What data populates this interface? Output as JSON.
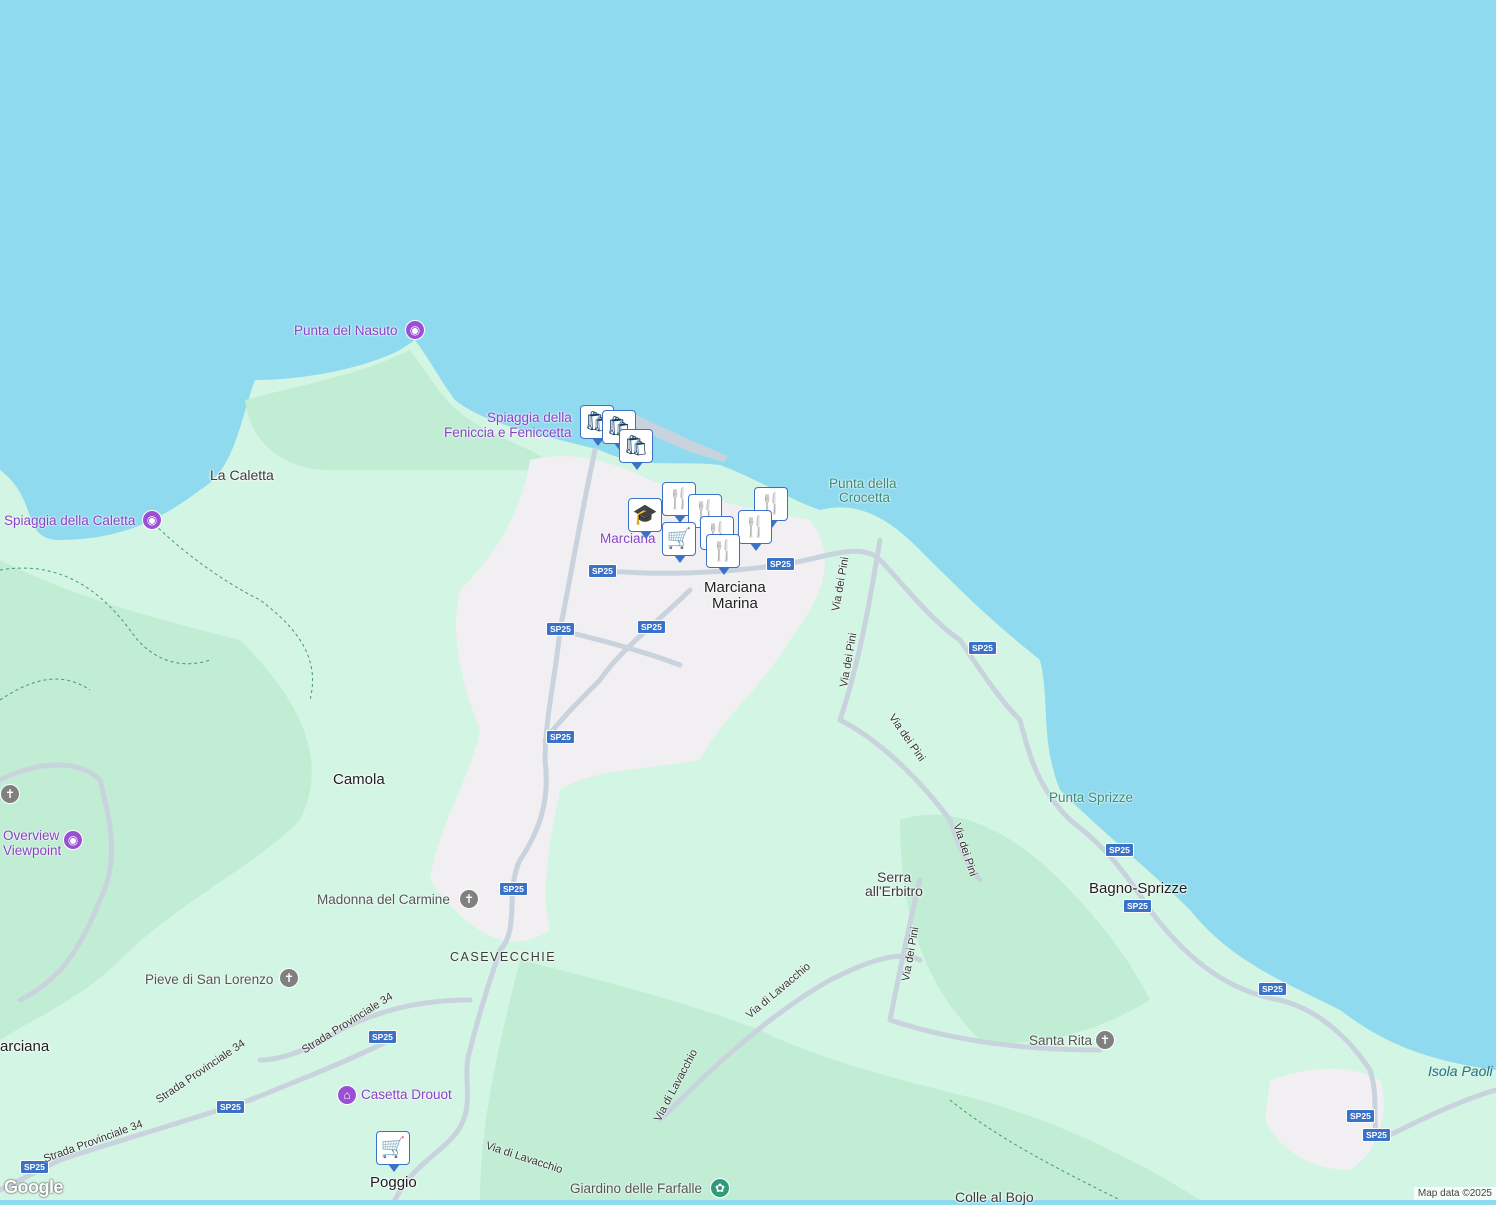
{
  "map": {
    "attribution": "Map data ©2025",
    "logo": "Google",
    "colors": {
      "sea": "#8fdaee",
      "land": "#d3f5e3",
      "forest": "#c0edd4",
      "urban": "#f1eff2",
      "road": "#c9d3de",
      "shield": "#3a72c8"
    }
  },
  "labels": {
    "punta_del_nasuto": "Punta del Nasuto",
    "spiaggia_feniccia_1": "Spiaggia della",
    "spiaggia_feniccia_2": "Feniccia e Feniccetta",
    "la_caletta": "La Caletta",
    "spiaggia_caletta": "Spiaggia della Caletta",
    "punta_crocetta_1": "Punta della",
    "punta_crocetta_2": "Crocetta",
    "marciana_poi": "Marciana",
    "marciana_marina_1": "Marciana",
    "marciana_marina_2": "Marina",
    "camola": "Camola",
    "overview_1": "Overview",
    "overview_2": "Viewpoint",
    "madonna_del_carmine": "Madonna del Carmine",
    "casevecchie": "CASEVECCHIE",
    "pieve_san_lorenzo": "Pieve di San Lorenzo",
    "marciana_town": "arciana",
    "casetta_drouot": "Casetta Drouot",
    "poggio": "Poggio",
    "giardino_farfalle": "Giardino delle Farfalle",
    "colle_al_bojo": "Colle al Bojo",
    "santa_rita": "Santa Rita",
    "serra_1": "Serra",
    "serra_2": "all'Erbitro",
    "punta_sprizze": "Punta Sprizze",
    "bagno_sprizze": "Bagno-Sprizze",
    "isola_paolina": "Isola Paoli"
  },
  "streets": {
    "via_dei_pini": "Via dei Pini",
    "via_di_lavacchio": "Via di Lavacchio",
    "strada_provinciale_34": "Strada Provinciale 34",
    "sp25": "SP25"
  },
  "markers": [
    {
      "icon": "shopping-bag-icon",
      "glyph": "🛍"
    },
    {
      "icon": "shopping-bag-icon",
      "glyph": "🛍"
    },
    {
      "icon": "shopping-bag-icon",
      "glyph": "🛍"
    },
    {
      "icon": "school-icon",
      "glyph": "🎓"
    },
    {
      "icon": "restaurant-icon",
      "glyph": "🍴"
    },
    {
      "icon": "restaurant-icon",
      "glyph": "🍴"
    },
    {
      "icon": "restaurant-icon",
      "glyph": "🍴"
    },
    {
      "icon": "restaurant-icon",
      "glyph": "🍴"
    },
    {
      "icon": "restaurant-icon",
      "glyph": "🍴"
    },
    {
      "icon": "shopping-cart-icon",
      "glyph": "🛒"
    },
    {
      "icon": "restaurant-icon",
      "glyph": "🍴"
    },
    {
      "icon": "shopping-cart-icon",
      "glyph": "🛒"
    }
  ]
}
